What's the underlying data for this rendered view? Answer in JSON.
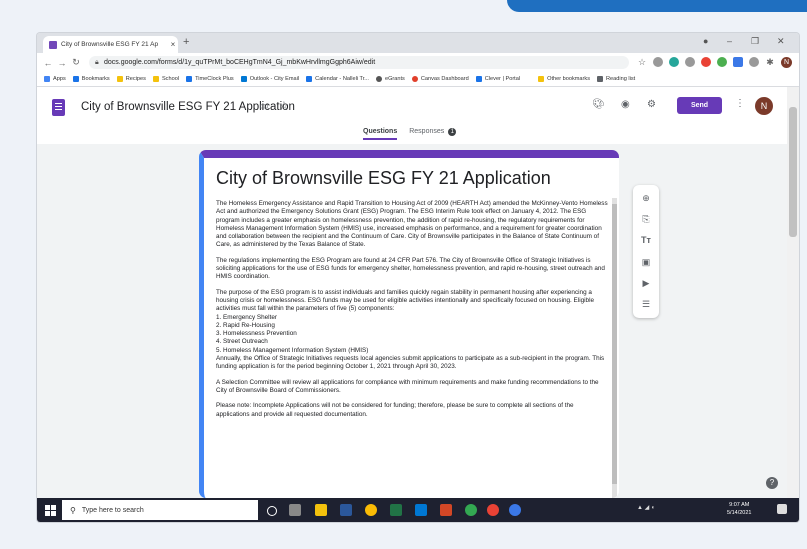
{
  "browser": {
    "tab_title": "City of Brownsville ESG FY 21 Ap",
    "new_tab": "+",
    "url": "docs.google.com/forms/d/1y_quTPrMt_boCEHgTmN4_Gj_mbKwHrvllmgGgph6Aiw/edit",
    "bookmarks": [
      "Apps",
      "Bookmarks",
      "Recipes",
      "School",
      "TimeClock Plus",
      "Outlook - City Email",
      "Calendar - Nalleli Tr...",
      "eGrants",
      "Canvas Dashboard",
      "Clever | Portal",
      "Other bookmarks",
      "Reading list"
    ],
    "profile_initial": "N"
  },
  "forms": {
    "title": "City of Brownsville ESG FY 21 Application",
    "send_label": "Send",
    "tab_questions": "Questions",
    "tab_responses": "Responses",
    "responses_count": "1",
    "avatar_initial": "N"
  },
  "card": {
    "heading": "City of Brownsville ESG FY 21 Application",
    "para1": "The Homeless Emergency Assistance and Rapid Transition to Housing Act of 2009 (HEARTH Act) amended the McKinney-Vento Homeless Act and authorized the Emergency Solutions Grant (ESG) Program. The ESG Interim Rule took effect on January 4, 2012. The ESG program includes a greater emphasis on homelessness prevention, the addition of rapid re-housing, the regulatory requirements for Homeless Management Information System (HMIS) use, increased emphasis on performance, and a requirement for greater coordination and collaboration between the recipient and the Continuum of Care. City of Brownsville participates in the Balance of State Continuum of Care, as administered by the Texas Balance of State.",
    "para2": "The regulations implementing the ESG Program are found at 24 CFR Part 576. The City of Brownsville Office of Strategic Initiatives is soliciting applications for the use of ESG funds for emergency shelter, homelessness prevention, and rapid re-housing, street outreach and HMIS coordination.",
    "para3": "The purpose of the ESG program is to assist individuals and families quickly regain stability in permanent housing after experiencing a housing crisis or homelessness. ESG funds may be used for eligible activities intentionally and specifically focused on housing. Eligible activities must fall within the parameters of five (5) components:",
    "list": [
      "1.   Emergency Shelter",
      "2.   Rapid Re-Housing",
      "3.   Homelessness Prevention",
      "4.   Street Outreach",
      "5.   Homeless Management Information System (HMIS)"
    ],
    "para4": "Annually, the Office of Strategic Initiatives requests local agencies submit applications to participate as a sub-recipient in the program. This funding application is for the period beginning October 1, 2021 through April 30, 2023.",
    "para5": "A Selection Committee will review all applications for compliance with minimum requirements and make funding recommendations to the City of Brownsville Board of Commissioners.",
    "para6": "Please note: Incomplete Applications will not be considered for funding; therefore, please be sure to complete all sections of the applications and provide all requested documentation."
  },
  "taskbar": {
    "search_placeholder": "Type here to search",
    "time": "9:07 AM",
    "date": "5/14/2021"
  },
  "colors": {
    "accent": "#673ab7",
    "link_blue": "#4285f4",
    "taskbar": "#1e2130"
  }
}
